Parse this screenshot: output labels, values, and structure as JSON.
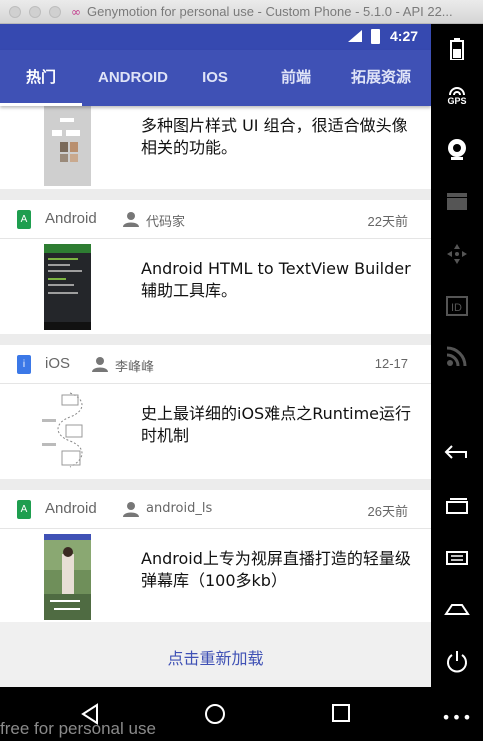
{
  "window": {
    "title": "Genymotion for personal use - Custom Phone - 5.1.0 - API 22..."
  },
  "status": {
    "time": "4:27"
  },
  "tabs": [
    {
      "label": "热门"
    },
    {
      "label": "ANDROID"
    },
    {
      "label": "IOS"
    },
    {
      "label": "前端"
    },
    {
      "label": "拓展资源"
    }
  ],
  "cards": [
    {
      "desc": "多种图片样式 UI 组合，很适合做头像相关的功能。"
    },
    {
      "platform_icon": "A",
      "platform": "Android",
      "author": "代码家",
      "when": "22天前",
      "desc": "Android HTML to TextView Builder 辅助工具库。"
    },
    {
      "platform_icon": "i",
      "platform": "iOS",
      "author": "李峰峰",
      "when": "12-17",
      "desc": "史上最详细的iOS难点之Runtime运行时机制"
    },
    {
      "platform_icon": "A",
      "platform": "Android",
      "author": "android_ls",
      "when": "26天前",
      "desc": "Android上专为视屏直播打造的轻量级弹幕库（100多kb）"
    }
  ],
  "reload_label": "点击重新加载",
  "watermark": "free for personal use",
  "colors": {
    "primary": "#3f51b5",
    "status_bar": "#3649b0",
    "android": "#1e9e4f",
    "ios": "#3b78e7"
  }
}
